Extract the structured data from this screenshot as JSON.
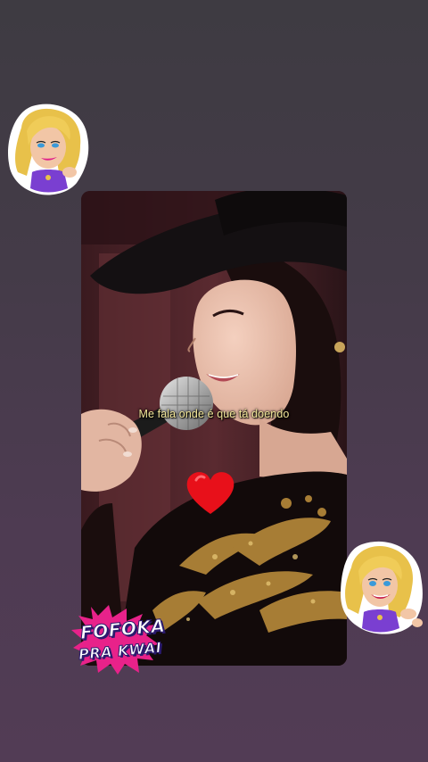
{
  "video": {
    "subtitle": "Me fala onde é que tá doendo"
  },
  "overlay": {
    "brand_logo_line_1": "FOFOKA",
    "brand_logo_line_2": "PRA KWAI",
    "reaction_icon": "heart-icon",
    "sticker_icon": "cartoon-blonde-woman-sticker"
  },
  "colors": {
    "background": "#463c4a",
    "subtitle_text": "#f3e79a",
    "heart": "#e8101a",
    "logo_burst": "#e8228a"
  }
}
